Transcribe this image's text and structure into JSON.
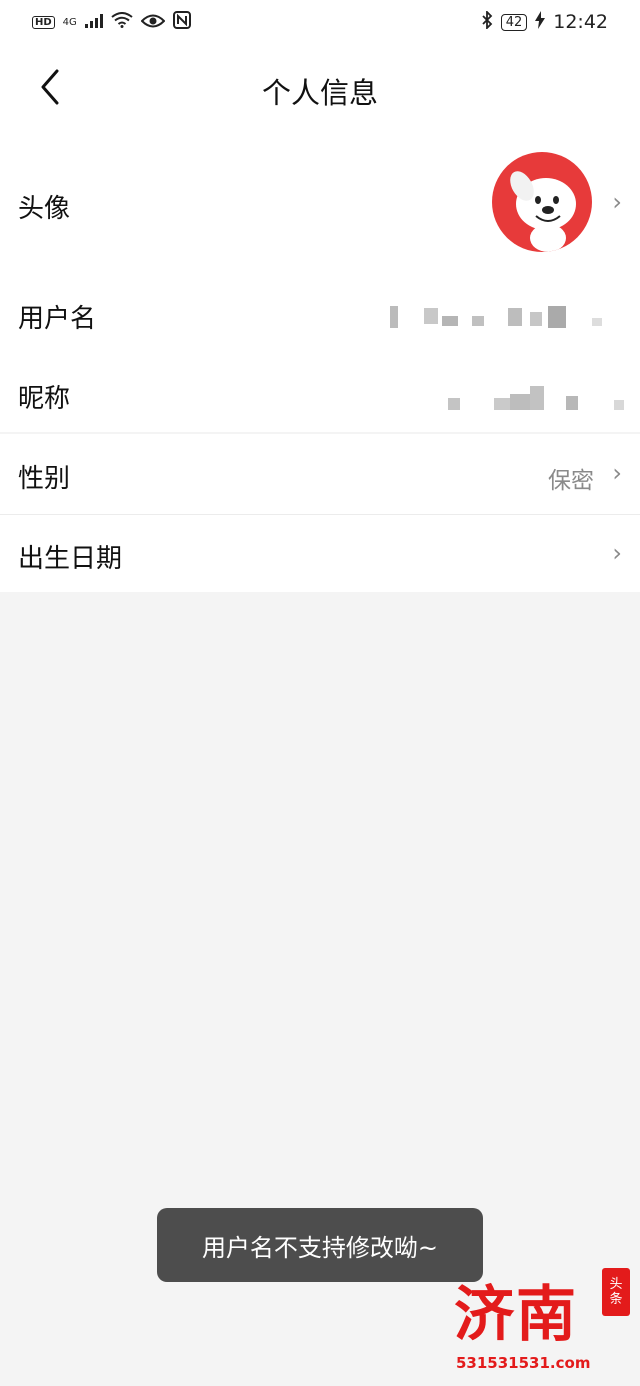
{
  "status_bar": {
    "hd": "HD",
    "signal": "4G",
    "battery": "42",
    "time": "12:42"
  },
  "header": {
    "title": "个人信息"
  },
  "rows": {
    "avatar_label": "头像",
    "username_label": "用户名",
    "nickname_label": "昵称",
    "gender_label": "性别",
    "gender_value": "保密",
    "birthday_label": "出生日期"
  },
  "toast": {
    "message": "用户名不支持修改呦~"
  },
  "watermark": {
    "brand": "济南",
    "badge_line1": "头",
    "badge_line2": "条",
    "url": "531531531.com"
  },
  "colors": {
    "accent_red": "#e31b1b",
    "avatar_bg": "#e73a3a",
    "page_bg": "#f4f4f4",
    "toast_bg": "#4d4d4d"
  }
}
